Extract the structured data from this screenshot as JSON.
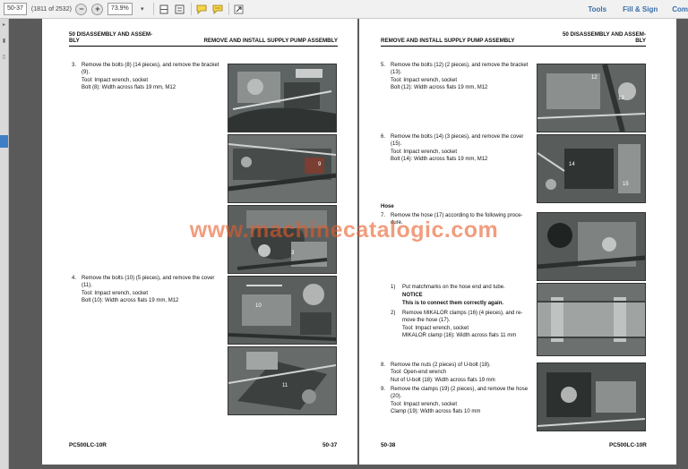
{
  "toolbar": {
    "page_input": "50-37",
    "page_count": "(1811 of 2532)",
    "zoom": "73.9%",
    "tools_label": "Tools",
    "fill_sign_label": "Fill & Sign",
    "comment_label": "Com"
  },
  "watermark": "www.machinecatalogic.com",
  "left_page": {
    "header_section_line1": "50 DISASSEMBLY AND ASSEM-",
    "header_section_line2": "BLY",
    "header_title": "REMOVE AND INSTALL SUPPLY PUMP ASSEMBLY",
    "step3_num": "3.",
    "step3_line1": "Remove the bolts (8) (14 pieces), and remove the bracket",
    "step3_line2": "(9).",
    "step3_tool": "Tool: Impact wrench, socket",
    "step3_bolt": "Bolt (8): Width across flats 19 mm, M12",
    "step4_num": "4.",
    "step4_line1": "Remove the bolts (10) (5 pieces), and remove the cover",
    "step4_line2": "(11).",
    "step4_tool": "Tool: Impact wrench, socket",
    "step4_bolt": "Bolt (10): Width across flats 19 mm, M12",
    "footer_model": "PC500LC-10R",
    "footer_page": "50-37",
    "photo_labels": [
      "9",
      "3",
      "10",
      "11"
    ]
  },
  "right_page": {
    "header_title": "REMOVE AND INSTALL SUPPLY PUMP ASSEMBLY",
    "header_section_line1": "50 DISASSEMBLY AND ASSEM-",
    "header_section_line2": "BLY",
    "step5_num": "5.",
    "step5_line1": "Remove the bolts (12) (2 pieces), and remove the bracket",
    "step5_line2": "(13).",
    "step5_tool": "Tool: Impact wrench, socket",
    "step5_bolt": "Bolt (12): Width across flats 19 mm, M12",
    "step6_num": "6.",
    "step6_line1": "Remove the bolts (14) (3 pieces), and remove the cover",
    "step6_line2": "(15).",
    "step6_tool": "Tool: Impact wrench, socket",
    "step6_bolt": "Bolt (14): Width across flats 19 mm, M12",
    "hose_heading": "Hose",
    "step7_num": "7.",
    "step7_line1": "Remove the hose (17) according to the following proce-",
    "step7_line2": "dure.",
    "sub1_num": "1)",
    "sub1_text": "Put matchmarks on the hose end and tube.",
    "notice_label": "NOTICE",
    "notice_text": "This is to connect them correctly again.",
    "sub2_num": "2)",
    "sub2_line1": "Remove MIKALOR clamps (16) (4 pieces), and re-",
    "sub2_line2": "move the hose (17).",
    "sub2_tool": "Tool: Impact wrench, socket",
    "sub2_clamp": "MIKALOR clamp (16): Width across flats 11 mm",
    "step8_num": "8.",
    "step8_line1": "Remove the nuts (2 pieces) of U-bolt (18).",
    "step8_tool": "Tool: Open-end wrench",
    "step8_nut": "Nut of U-bolt (18): Width across flats 19 mm",
    "step9_num": "9.",
    "step9_line1": "Remove the clamps (19) (2 pieces), and remove the hose",
    "step9_line2": "(20).",
    "step9_tool": "Tool: Impact wrench, socket",
    "step9_clamp": "Clamp (19): Width across flats 10 mm",
    "footer_page": "50-38",
    "footer_model": "PC500LC-10R",
    "photo_labels": [
      "12",
      "13",
      "14",
      "15"
    ]
  },
  "colors": {
    "link": "#3a6fa8",
    "watermark": "#e85c28",
    "accent_blue": "#3d7ec6"
  }
}
